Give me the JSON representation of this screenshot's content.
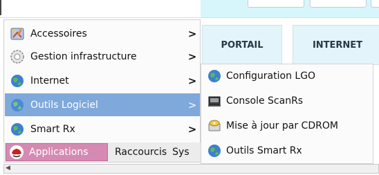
{
  "menu": {
    "items": [
      {
        "label": "Accessoires",
        "icon": "accessories-icon",
        "has_submenu": true,
        "selected": false
      },
      {
        "label": "Gestion infrastructure",
        "icon": "system-settings-icon",
        "has_submenu": true,
        "selected": false
      },
      {
        "label": "Internet",
        "icon": "globe-icon",
        "has_submenu": true,
        "selected": false
      },
      {
        "label": "Outils Logiciel",
        "icon": "globe-icon",
        "has_submenu": true,
        "selected": true
      },
      {
        "label": "Smart Rx",
        "icon": "globe-icon",
        "has_submenu": true,
        "selected": false
      }
    ],
    "arrow": ">"
  },
  "submenu": {
    "items": [
      {
        "label": "Configuration LGO",
        "icon": "globe-icon"
      },
      {
        "label": "Console ScanRs",
        "icon": "scanner-icon"
      },
      {
        "label": "Mise à jour par CDROM",
        "icon": "cdrom-update-icon"
      },
      {
        "label": "Outils Smart Rx",
        "icon": "globe-icon"
      }
    ]
  },
  "taskbar": {
    "applications_label": "Applications",
    "shortcuts_label": "Raccourcis",
    "system_label": "Sys"
  },
  "tabs": {
    "portail": "PORTAIL",
    "internet": "INTERNET"
  },
  "colors": {
    "selection": "#7fa8db",
    "applications_button": "#d48ab3",
    "tab_background": "#e3f5fb"
  }
}
